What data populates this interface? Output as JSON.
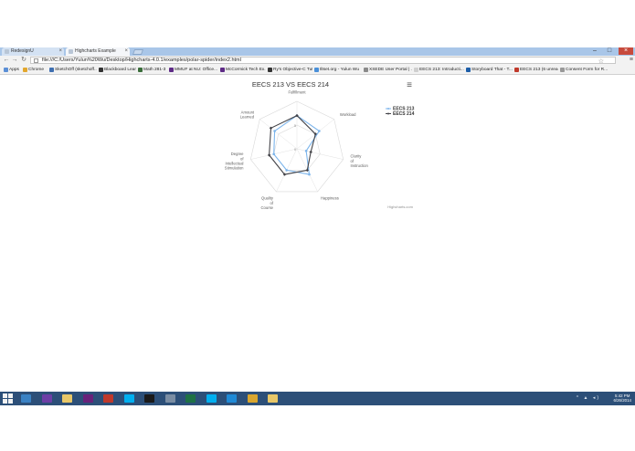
{
  "browser": {
    "tabs": [
      {
        "label": "RedesignU",
        "active": false
      },
      {
        "label": "Highcharts Example",
        "active": true
      }
    ],
    "close_glyph": "×",
    "address": "file:///C:/Users/Yulun%20Wu/Desktop/Highcharts-4.0.1/examples/polar-spider/index2.html",
    "bookmarks": [
      {
        "label": "Apps",
        "color": "#5b8fd6"
      },
      {
        "label": "Chrome",
        "color": "#e2a72e"
      },
      {
        "label": "SketchOff (sketchoff...",
        "color": "#3f6fb0"
      },
      {
        "label": "Blackboard Learn",
        "color": "#333333"
      },
      {
        "label": "Math 281-3",
        "color": "#3a6d3a"
      },
      {
        "label": "MMUF at NU: Office...",
        "color": "#5e2b86"
      },
      {
        "label": "McCormick Tech Ex...",
        "color": "#5e2b86"
      },
      {
        "label": "Ry's Objective-C Tut...",
        "color": "#333333"
      },
      {
        "label": "tltset.org - Yulun Wu",
        "color": "#4a90d9"
      },
      {
        "label": "XSEDE User Portal | ...",
        "color": "#8a8a8a"
      },
      {
        "label": "EECS 213: Introducti...",
        "color": "#cfcfcf"
      },
      {
        "label": "Storyboard That - T...",
        "color": "#1d5ea8"
      },
      {
        "label": "EECS 213 (6 unread)",
        "color": "#c0392b"
      },
      {
        "label": "Consent Form for R...",
        "color": "#999999"
      }
    ]
  },
  "chart_data": {
    "type": "radar",
    "title": "EECS 213 VS EECS 214",
    "categories": [
      "Fulfillment",
      "Workload",
      "Clarity of Instruction",
      "Happiness",
      "Quality of Course",
      "Degree of Intellectual Stimulation",
      "Amount Learned"
    ],
    "category_lines": [
      [
        "Fulfillment"
      ],
      [
        "Workload"
      ],
      [
        "Clarity",
        "of",
        "Instruction"
      ],
      [
        "Happiness"
      ],
      [
        "Quality",
        "of",
        "Course"
      ],
      [
        "Degree",
        "of",
        "Intellectual",
        "Stimulation"
      ],
      [
        "Amount",
        "Learned"
      ]
    ],
    "ylim": [
      0,
      10
    ],
    "tick_labels": [
      "5",
      "0"
    ],
    "series": [
      {
        "name": "EECS 213",
        "values": [
          7,
          6,
          2,
          6,
          5,
          5,
          6
        ],
        "color": "#7cb5ec"
      },
      {
        "name": "EECS 214",
        "values": [
          7,
          5,
          3,
          5,
          6,
          6,
          7
        ],
        "color": "#434348"
      }
    ],
    "legend": "top-right",
    "credits": "Highcharts.com",
    "menu_glyph": "≡"
  },
  "taskbar": {
    "apps": [
      {
        "name": "explorer-app",
        "color": "#3a82c4"
      },
      {
        "name": "vs-app",
        "color": "#6d3fa6"
      },
      {
        "name": "folder-app",
        "color": "#e8c768"
      },
      {
        "name": "visual-studio-app",
        "color": "#68217a"
      },
      {
        "name": "sublime-app",
        "color": "#c0392b"
      },
      {
        "name": "skype-app",
        "color": "#00aff0"
      },
      {
        "name": "terminal-app",
        "color": "#1a1a1a"
      },
      {
        "name": "network-app",
        "color": "#7a8da3"
      },
      {
        "name": "excel-app",
        "color": "#1e7145"
      },
      {
        "name": "skype2-app",
        "color": "#00aff0"
      },
      {
        "name": "ie-app",
        "color": "#1f8ad6"
      },
      {
        "name": "chrome-app",
        "color": "#d9a62e"
      },
      {
        "name": "folder2-app",
        "color": "#e8c768"
      }
    ],
    "clock_time": "5:42 PM",
    "clock_date": "6/26/2014"
  }
}
